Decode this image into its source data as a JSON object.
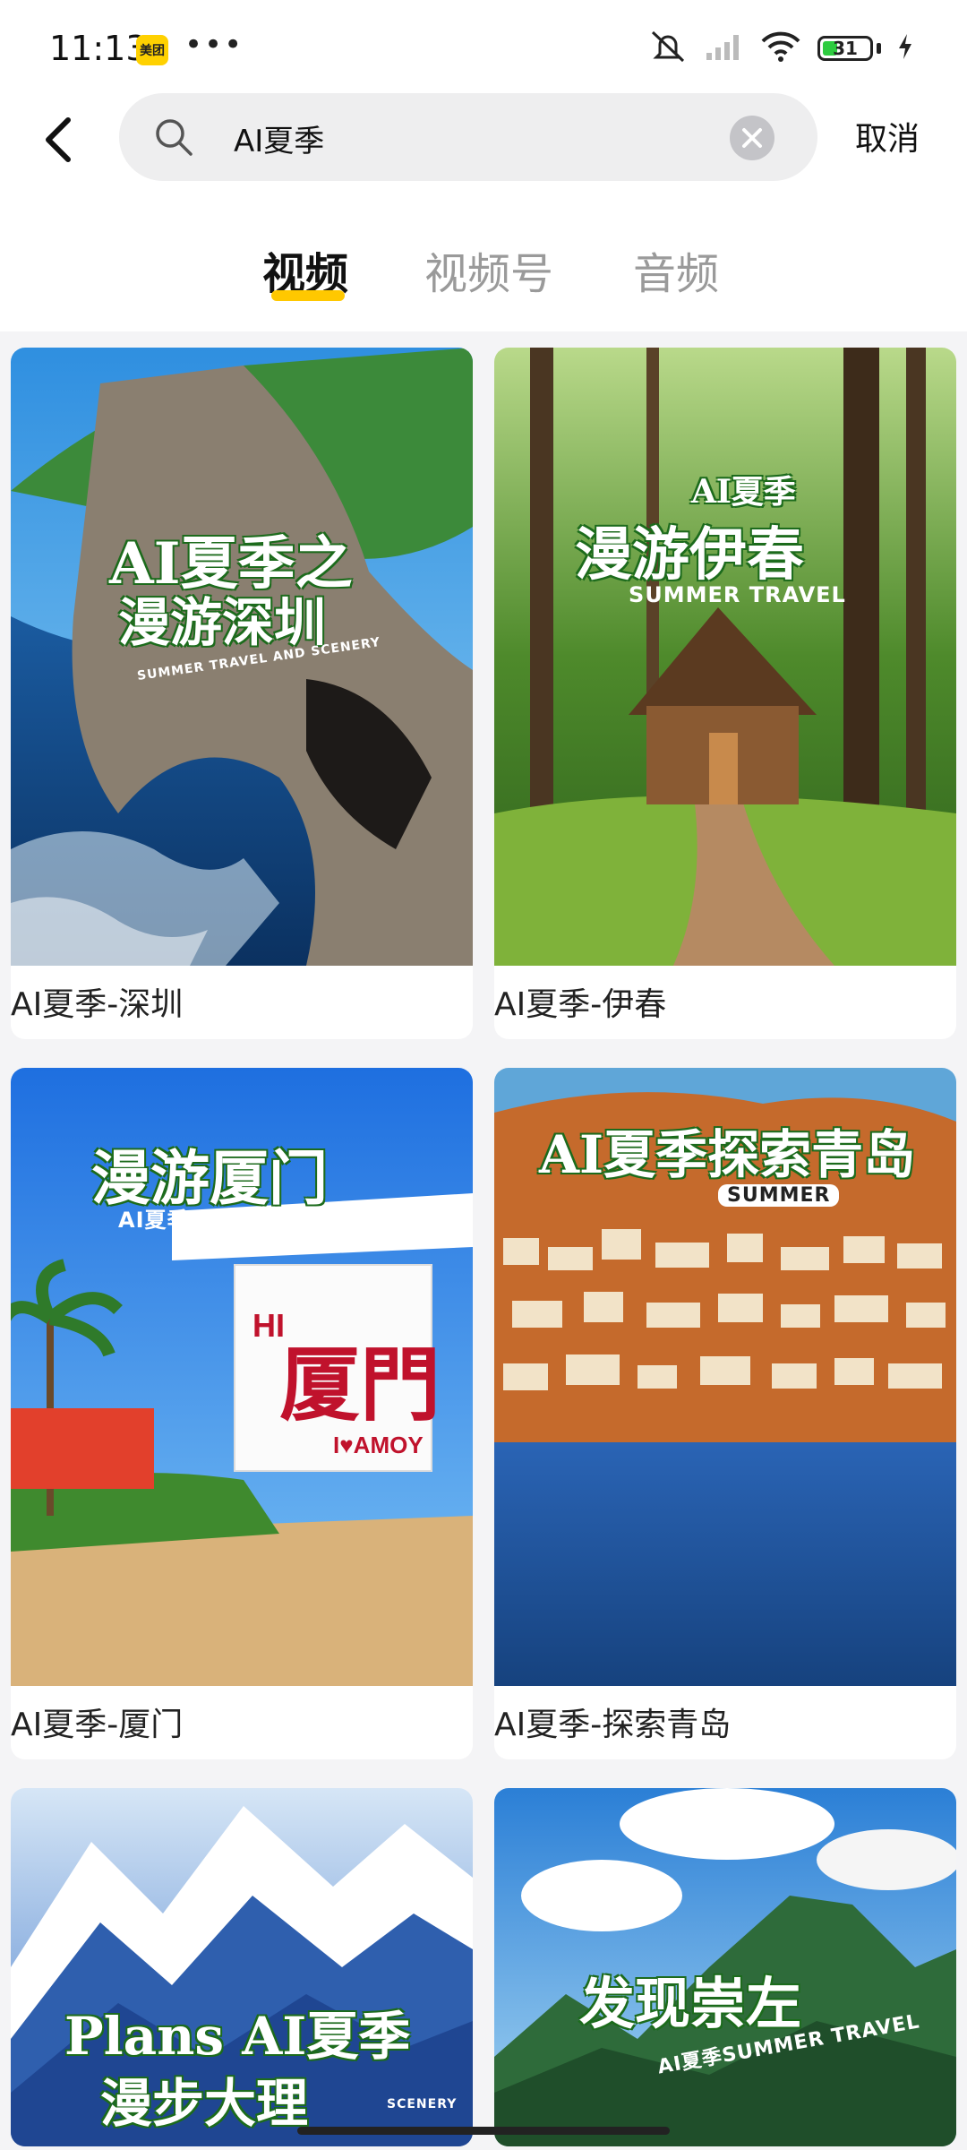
{
  "status_bar": {
    "time": "11:13",
    "app_badge": "美团",
    "more_dots": "•••",
    "battery_level": "31",
    "icons": [
      "mute-icon",
      "signal-icon",
      "wifi-icon",
      "battery-icon",
      "charging-icon"
    ]
  },
  "search": {
    "query": "AI夏季",
    "cancel_label": "取消"
  },
  "tabs": [
    {
      "label": "视频",
      "active": true
    },
    {
      "label": "视频号",
      "active": false
    },
    {
      "label": "音频",
      "active": false
    }
  ],
  "results": [
    {
      "title": "AI夏季-深圳",
      "overlay_main": "AI夏季之",
      "overlay_line2": "漫游深圳",
      "overlay_sub": "SUMMER TRAVEL AND SCENERY"
    },
    {
      "title": "AI夏季-伊春",
      "overlay_main": "AI夏季",
      "overlay_line2": "漫游伊春",
      "overlay_sub": "SUMMER TRAVEL"
    },
    {
      "title": "AI夏季-厦门",
      "overlay_main": "漫游厦门",
      "overlay_line2": "AI夏季 BY ZHE SUMMER",
      "overlay_sub": "HI 厦門 I♥AMOY"
    },
    {
      "title": "AI夏季-探索青岛",
      "overlay_main": "AI夏季探索青岛",
      "overlay_line2": "SUMMER",
      "overlay_sub": ""
    },
    {
      "title": "",
      "overlay_main": "Plans AI夏季",
      "overlay_line2": "漫步大理",
      "overlay_sub": "SCENERY"
    },
    {
      "title": "",
      "overlay_main": "发现崇左",
      "overlay_line2": "AI夏季SUMMER TRAVEL",
      "overlay_sub": ""
    }
  ]
}
